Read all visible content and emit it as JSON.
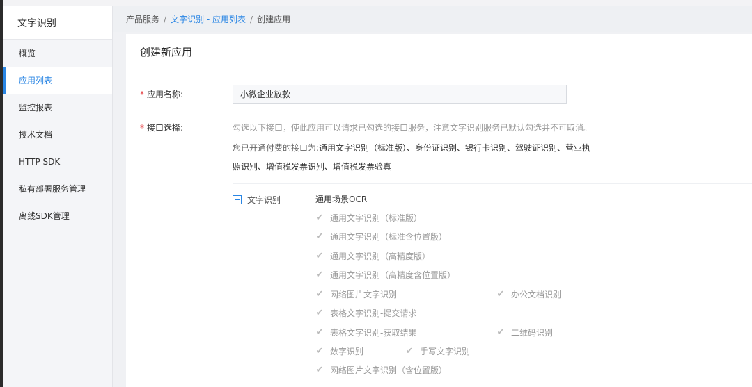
{
  "sidebar": {
    "title": "文字识别",
    "items": [
      {
        "label": "概览"
      },
      {
        "label": "应用列表"
      },
      {
        "label": "监控报表"
      },
      {
        "label": "技术文档"
      },
      {
        "label": "HTTP SDK"
      },
      {
        "label": "私有部署服务管理"
      },
      {
        "label": "离线SDK管理"
      }
    ],
    "active_index": 1
  },
  "breadcrumb": {
    "root": "产品服务",
    "link": "文字识别 - 应用列表",
    "current": "创建应用",
    "separator": "/"
  },
  "form": {
    "title": "创建新应用",
    "name_label": "应用名称:",
    "name_value": "小微企业放款",
    "api_label": "接口选择:",
    "required_mark": "*",
    "hint": "勾选以下接口，使此应用可以请求已勾选的接口服务，注意文字识别服务已默认勾选并不可取消。",
    "paid_prefix": "您已开通付费的接口为:",
    "paid_apis": "通用文字识别（标准版）、身份证识别、银行卡识别、驾驶证识别、营业执照识别、增值税发票识别、增值税发票验真"
  },
  "api_group": {
    "name": "文字识别",
    "section": "通用场景OCR",
    "checkboxes": [
      {
        "label": "通用文字识别（标准版）",
        "checked": true
      },
      {
        "label": "通用文字识别（标准含位置版）",
        "checked": true
      },
      {
        "label": "通用文字识别（高精度版）",
        "checked": true
      },
      {
        "label": "通用文字识别（高精度含位置版）",
        "checked": true
      },
      {
        "label": "网络图片文字识别",
        "checked": true
      },
      {
        "label": "办公文档识别",
        "checked": true
      },
      {
        "label": "表格文字识别-提交请求",
        "checked": true
      },
      {
        "label": "表格文字识别-获取结果",
        "checked": true
      },
      {
        "label": "二维码识别",
        "checked": true
      },
      {
        "label": "数字识别",
        "checked": true
      },
      {
        "label": "手写文字识别",
        "checked": true
      },
      {
        "label": "网络图片文字识别（含位置版）",
        "checked": true
      }
    ]
  }
}
